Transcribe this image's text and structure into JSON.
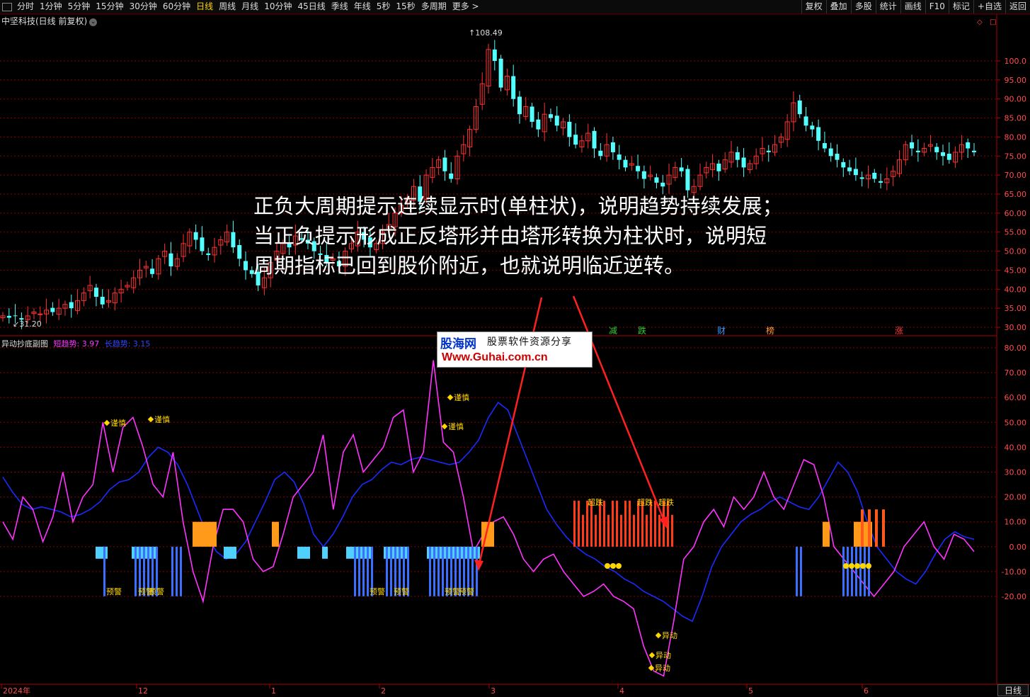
{
  "toolbar": {
    "periods": [
      "分时",
      "1分钟",
      "5分钟",
      "15分钟",
      "30分钟",
      "60分钟",
      "日线",
      "周线",
      "月线",
      "10分钟",
      "45日线",
      "季线",
      "年线",
      "5秒",
      "15秒",
      "多周期",
      "更多 >"
    ],
    "active_period": "日线",
    "right_buttons": [
      "复权",
      "叠加",
      "多股",
      "统计",
      "画线",
      "F10",
      "标记",
      "+自选",
      "返回"
    ]
  },
  "stock_title": "中坚科技(日线 前复权)",
  "main_chart": {
    "price_axis_labels": [
      "100.0",
      "95.00",
      "90.00",
      "85.00",
      "80.00",
      "75.00",
      "70.00",
      "65.00",
      "60.00",
      "55.00",
      "50.00",
      "45.00",
      "40.00",
      "35.00",
      "30.00"
    ],
    "high_label": "108.49",
    "low_label": "31.20",
    "event_tags": [
      {
        "text": "减",
        "color": "#33cc33"
      },
      {
        "text": "跌",
        "color": "#33cc33"
      },
      {
        "text": "财",
        "color": "#3399ff"
      },
      {
        "text": "榜",
        "color": "#ff9933"
      },
      {
        "text": "涨",
        "color": "#ff3333"
      }
    ]
  },
  "sub_chart": {
    "name": "异动抄底副图",
    "short_label": "短趋势: 3.97",
    "long_label": "长趋势: 3.15",
    "axis_labels": [
      "80.00",
      "70.00",
      "60.00",
      "50.00",
      "40.00",
      "30.00",
      "20.00",
      "10.00",
      "0.00",
      "-10.00",
      "-20.00"
    ],
    "markers": {
      "caution": "谨慎",
      "warning": "预警",
      "anomaly": "异动",
      "super_drop": "超跌"
    }
  },
  "x_axis_labels": [
    "2024年",
    "12",
    "1",
    "2",
    "3",
    "4",
    "5",
    "6"
  ],
  "annotation_lines": [
    "正负大周期提示连续显示时(单柱状)，说明趋势持续发展；",
    "当正负提示形成正反塔形并由塔形转换为柱状时，说明短",
    "周期指标已回到股价附近，也就说明临近逆转。"
  ],
  "watermark": {
    "name": "股海网",
    "slogan": "股票软件资源分享",
    "url": "Www.Guhai.com.cn"
  },
  "period_label": "日线",
  "colors": {
    "up": "#ff3232",
    "down": "#54ffff",
    "short_line": "#ff33ff",
    "long_line": "#1a2bff",
    "grid": "#8b0000",
    "axis_text": "#ff4d4d",
    "arrow": "#ff2020"
  }
}
